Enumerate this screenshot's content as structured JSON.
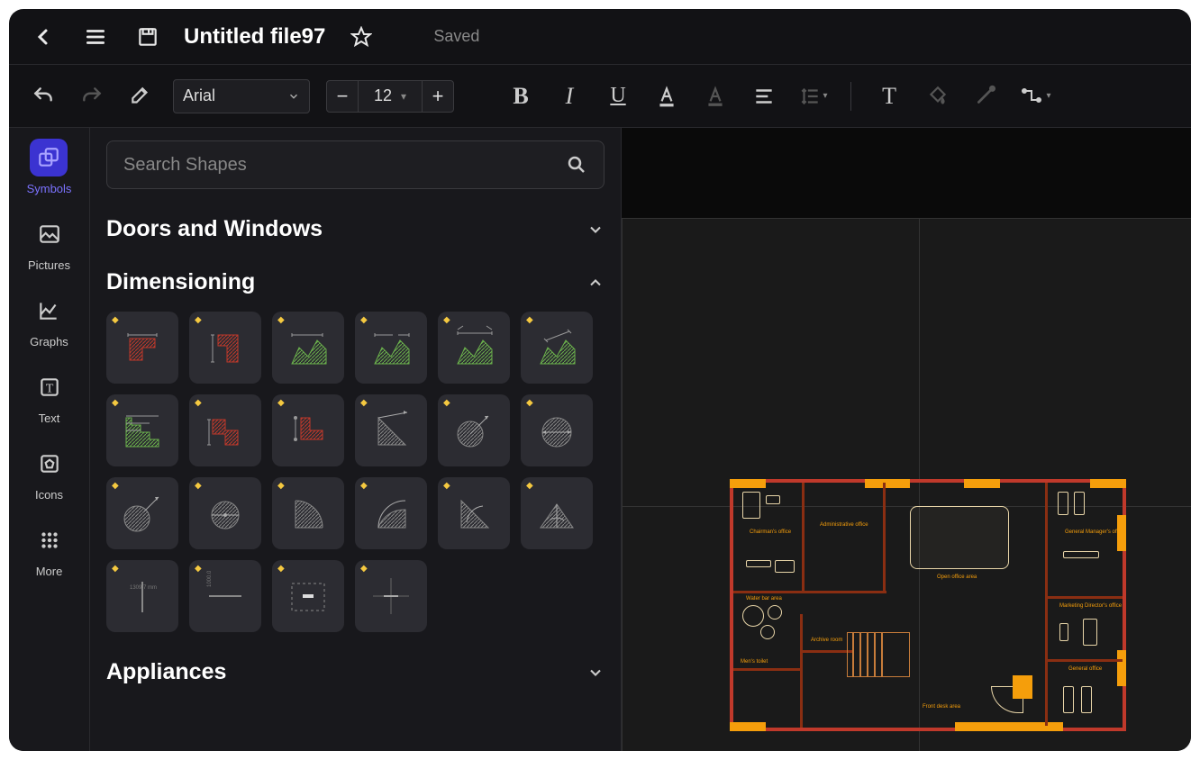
{
  "titlebar": {
    "file_title": "Untitled file97",
    "saved_label": "Saved"
  },
  "toolbar": {
    "font_name": "Arial",
    "font_size": "12"
  },
  "leftnav": {
    "items": [
      {
        "label": "Symbols"
      },
      {
        "label": "Pictures"
      },
      {
        "label": "Graphs"
      },
      {
        "label": "Text"
      },
      {
        "label": "Icons"
      },
      {
        "label": "More"
      }
    ]
  },
  "shapes": {
    "search_placeholder": "Search Shapes",
    "categories": [
      {
        "title": "Doors and Windows",
        "expanded": false
      },
      {
        "title": "Dimensioning",
        "expanded": true
      },
      {
        "title": "Appliances",
        "expanded": false
      }
    ]
  },
  "floorplan": {
    "rooms": [
      "Chairman's office",
      "Administrative office",
      "General Manager's office",
      "Water bar area",
      "Men's toilet",
      "Archive room",
      "Open office area",
      "Marketing Director's office",
      "General office",
      "Front desk area"
    ]
  }
}
